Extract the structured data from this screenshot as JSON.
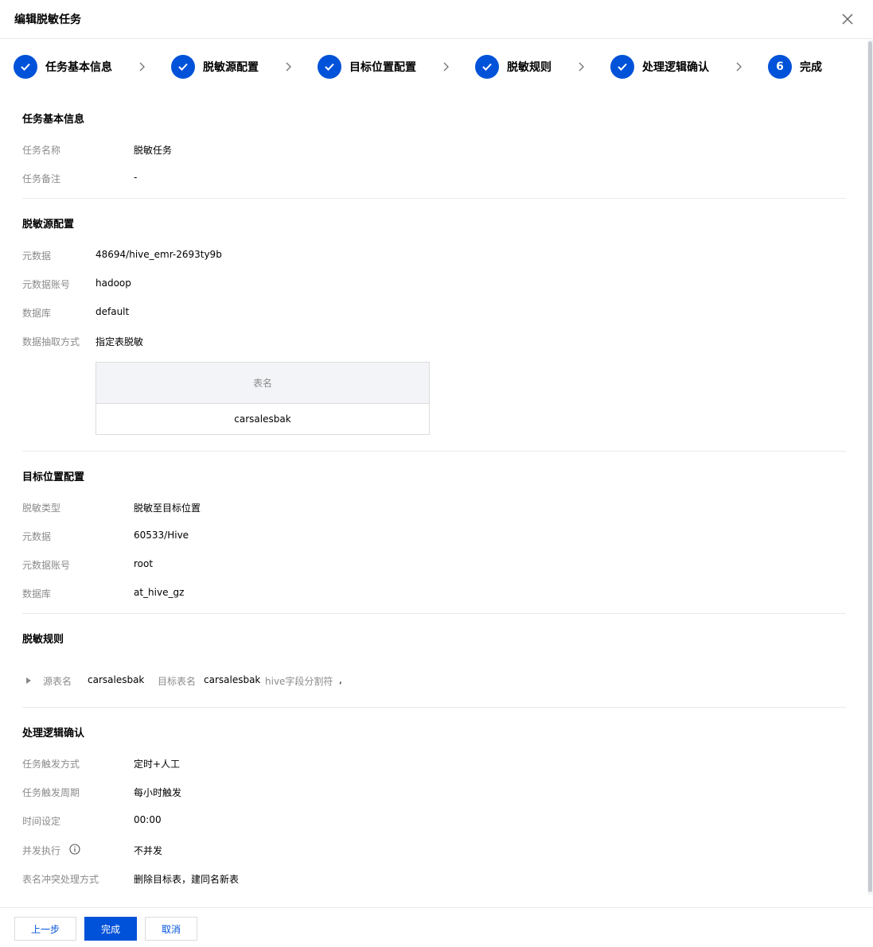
{
  "dialog": {
    "title": "编辑脱敏任务"
  },
  "steps": [
    {
      "label": "任务基本信息",
      "status": "done"
    },
    {
      "label": "脱敏源配置",
      "status": "done"
    },
    {
      "label": "目标位置配置",
      "status": "done"
    },
    {
      "label": "脱敏规则",
      "status": "done"
    },
    {
      "label": "处理逻辑确认",
      "status": "done"
    },
    {
      "label": "完成",
      "number": "6",
      "status": "current"
    }
  ],
  "basic_info": {
    "title": "任务基本信息",
    "fields": [
      {
        "label": "任务名称",
        "value": "脱敏任务"
      },
      {
        "label": "任务备注",
        "value": "-"
      }
    ]
  },
  "source_config": {
    "title": "脱敏源配置",
    "fields": [
      {
        "label": "元数据",
        "value": "48694/hive_emr-2693ty9b"
      },
      {
        "label": "元数据账号",
        "value": "hadoop"
      },
      {
        "label": "数据库",
        "value": "default"
      },
      {
        "label": "数据抽取方式",
        "value": "指定表脱敏"
      }
    ],
    "table": {
      "header": "表名",
      "rows": [
        "carsalesbak"
      ]
    }
  },
  "target_config": {
    "title": "目标位置配置",
    "fields": [
      {
        "label": "脱敏类型",
        "value": "脱敏至目标位置"
      },
      {
        "label": "元数据",
        "value": "60533/Hive"
      },
      {
        "label": "元数据账号",
        "value": "root"
      },
      {
        "label": "数据库",
        "value": "at_hive_gz"
      }
    ]
  },
  "rules": {
    "title": "脱敏规则",
    "source_label": "源表名",
    "source_value": "carsalesbak",
    "target_label": "目标表名",
    "target_value": "carsalesbak",
    "separator_label": "hive字段分割符",
    "separator_value": ","
  },
  "logic": {
    "title": "处理逻辑确认",
    "fields": [
      {
        "label": "任务触发方式",
        "value": "定时+人工"
      },
      {
        "label": "任务触发周期",
        "value": "每小时触发"
      },
      {
        "label": "时间设定",
        "value": "00:00"
      },
      {
        "label": "并发执行",
        "value": "不并发"
      },
      {
        "label": "表名冲突处理方式",
        "value": "删除目标表，建同名新表"
      }
    ]
  },
  "footer": {
    "prev": "上一步",
    "finish": "完成",
    "cancel": "取消"
  },
  "colors": {
    "primary": "#0052d9",
    "muted": "#8b8b8b",
    "divider": "#e7eaef"
  }
}
